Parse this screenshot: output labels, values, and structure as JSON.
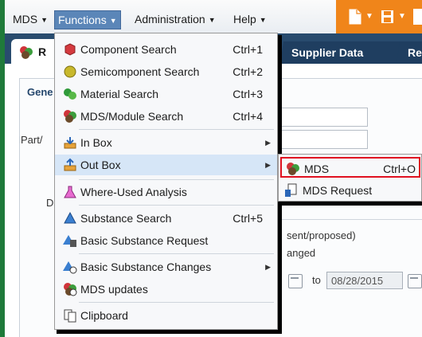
{
  "menubar": {
    "items": [
      {
        "label": "MDS"
      },
      {
        "label": "Functions"
      },
      {
        "label": "Administration"
      },
      {
        "label": "Help"
      }
    ]
  },
  "tabs": {
    "first_label": "R",
    "second_label": "Supplier Data",
    "third_label": "Re"
  },
  "form": {
    "section_label": "Gene",
    "part_label": "Part/",
    "d_label": "D",
    "present_text": "sent/proposed)",
    "changed_text": "anged",
    "to_label": "to",
    "date_value": "08/28/2015"
  },
  "functions_menu": {
    "items": [
      {
        "label": "Component Search",
        "shortcut": "Ctrl+1",
        "icon": "component-search-icon"
      },
      {
        "label": "Semicomponent Search",
        "shortcut": "Ctrl+2",
        "icon": "semicomponent-search-icon"
      },
      {
        "label": "Material Search",
        "shortcut": "Ctrl+3",
        "icon": "material-search-icon"
      },
      {
        "label": "MDS/Module Search",
        "shortcut": "Ctrl+4",
        "icon": "mds-module-search-icon"
      },
      {
        "label": "In Box",
        "shortcut": "",
        "icon": "in-box-icon"
      },
      {
        "label": "Out Box",
        "shortcut": "",
        "icon": "out-box-icon"
      },
      {
        "label": "Where-Used Analysis",
        "shortcut": "",
        "icon": "flask-icon"
      },
      {
        "label": "Substance Search",
        "shortcut": "Ctrl+5",
        "icon": "substance-search-icon"
      },
      {
        "label": "Basic Substance Request",
        "shortcut": "",
        "icon": "substance-request-icon"
      },
      {
        "label": "Basic Substance Changes",
        "shortcut": "",
        "icon": "substance-changes-icon"
      },
      {
        "label": "MDS updates",
        "shortcut": "",
        "icon": "mds-updates-icon"
      },
      {
        "label": "Clipboard",
        "shortcut": "",
        "icon": "clipboard-icon"
      }
    ]
  },
  "outbox_submenu": {
    "items": [
      {
        "label": "MDS",
        "shortcut": "Ctrl+O",
        "icon": "mds-icon"
      },
      {
        "label": "MDS Request",
        "shortcut": "",
        "icon": "mds-request-icon"
      }
    ]
  },
  "colors": {
    "accent_orange": "#f0851a",
    "tab_navy": "#1f3e60",
    "highlight": "#d6e6f7",
    "selection_red": "#e01020"
  }
}
